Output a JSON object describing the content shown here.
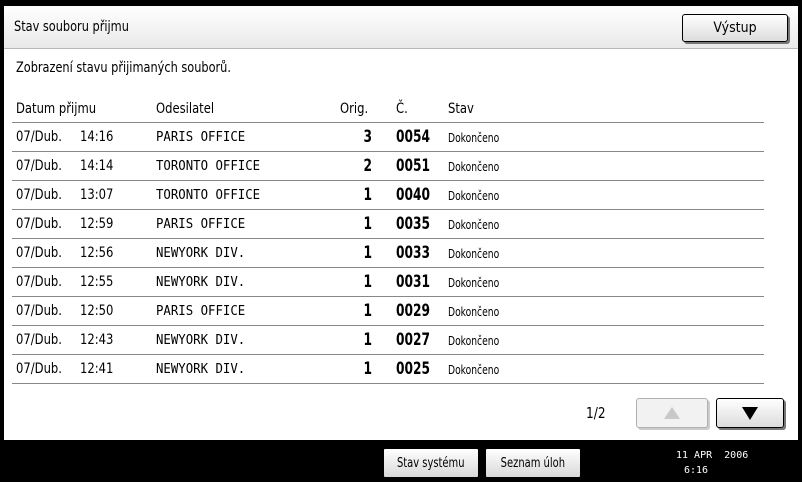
{
  "header": {
    "title": "Stav souboru přijmu",
    "exit_label": "Výstup"
  },
  "subtitle": "Zobrazení stavu přijimaných souborů.",
  "columns": {
    "date": "Datum přijmu",
    "sender": "Odesilatel",
    "orig": "Orig.",
    "num": "Č.",
    "status": "Stav"
  },
  "rows": [
    {
      "date": "07/Dub.",
      "time": "14:16",
      "sender": "PARIS OFFICE",
      "orig": "3",
      "num": "0054",
      "status": "Dokončeno"
    },
    {
      "date": "07/Dub.",
      "time": "14:14",
      "sender": "TORONTO OFFICE",
      "orig": "2",
      "num": "0051",
      "status": "Dokončeno"
    },
    {
      "date": "07/Dub.",
      "time": "13:07",
      "sender": "TORONTO OFFICE",
      "orig": "1",
      "num": "0040",
      "status": "Dokončeno"
    },
    {
      "date": "07/Dub.",
      "time": "12:59",
      "sender": "PARIS OFFICE",
      "orig": "1",
      "num": "0035",
      "status": "Dokončeno"
    },
    {
      "date": "07/Dub.",
      "time": "12:56",
      "sender": "NEWYORK DIV.",
      "orig": "1",
      "num": "0033",
      "status": "Dokončeno"
    },
    {
      "date": "07/Dub.",
      "time": "12:55",
      "sender": "NEWYORK DIV.",
      "orig": "1",
      "num": "0031",
      "status": "Dokončeno"
    },
    {
      "date": "07/Dub.",
      "time": "12:50",
      "sender": "PARIS OFFICE",
      "orig": "1",
      "num": "0029",
      "status": "Dokončeno"
    },
    {
      "date": "07/Dub.",
      "time": "12:43",
      "sender": "NEWYORK DIV.",
      "orig": "1",
      "num": "0027",
      "status": "Dokončeno"
    },
    {
      "date": "07/Dub.",
      "time": "12:41",
      "sender": "NEWYORK DIV.",
      "orig": "1",
      "num": "0025",
      "status": "Dokončeno"
    }
  ],
  "pagination": {
    "indicator": "1/2",
    "up_icon": "triangle-up-icon",
    "down_icon": "triangle-down-icon"
  },
  "footer": {
    "system_status_label": "Stav systému",
    "job_list_label": "Seznam úloh",
    "date": "11 APR  2006",
    "time": "6:16"
  }
}
